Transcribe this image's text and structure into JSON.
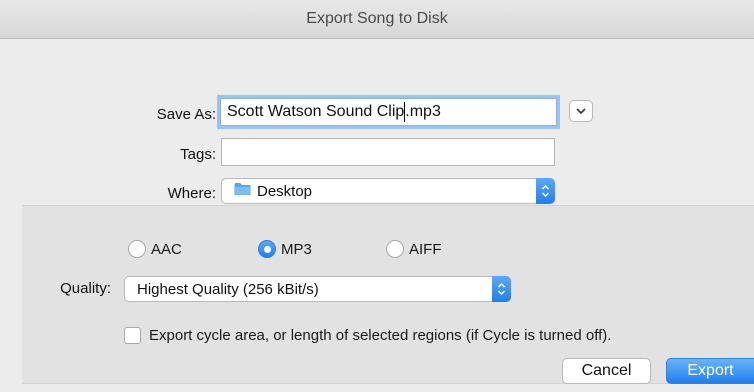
{
  "window": {
    "title": "Export Song to Disk"
  },
  "form": {
    "save_as_label": "Save As:",
    "save_as_value_before_caret": "Scott Watson Sound Clip",
    "save_as_value_after_caret": ".mp3",
    "tags_label": "Tags:",
    "tags_value": "",
    "where_label": "Where:",
    "where_value": "Desktop"
  },
  "format": {
    "options": [
      {
        "label": "AAC",
        "selected": false
      },
      {
        "label": "MP3",
        "selected": true
      },
      {
        "label": "AIFF",
        "selected": false
      }
    ]
  },
  "quality": {
    "label": "Quality:",
    "value": "Highest Quality (256 kBit/s)"
  },
  "cycle_option": {
    "label": "Export cycle area, or length of selected regions (if Cycle is turned off).",
    "checked": false
  },
  "buttons": {
    "cancel": "Cancel",
    "export": "Export"
  },
  "colors": {
    "accent": "#1f7ff0",
    "focus_ring": "#9cc3f0",
    "folder": "#5aa8e8"
  }
}
